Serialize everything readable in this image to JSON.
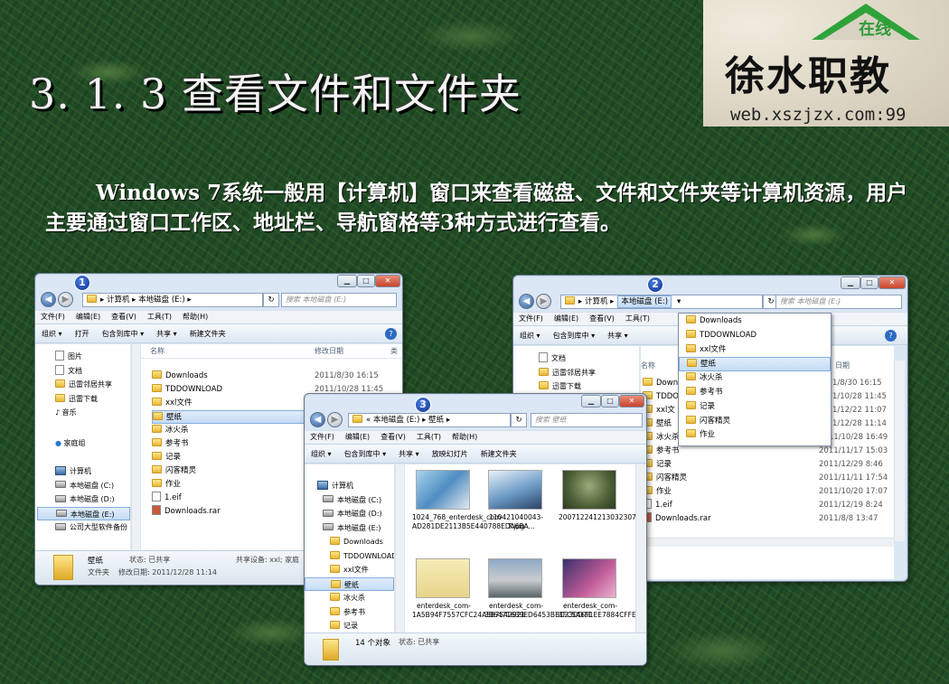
{
  "slide": {
    "title": "3. 1. 3  查看文件和文件夹",
    "paragraph": "Windows 7系统一般用【计算机】窗口来查看磁盘、文件和文件夹等计算机资源，用户主要通过窗口工作区、地址栏、导航窗格等3种方式进行查看。"
  },
  "logo": {
    "zaixian": "在线",
    "name": "徐水职教",
    "url": "web.xszjzx.com:99"
  },
  "badges": [
    "1",
    "2",
    "3"
  ],
  "win1": {
    "path": "▸ 计算机 ▸ 本地磁盘 (E:) ▸",
    "search_placeholder": "搜索 本地磁盘 (E:)",
    "menu": [
      "文件(F)",
      "编辑(E)",
      "查看(V)",
      "工具(T)",
      "帮助(H)"
    ],
    "toolbar": [
      "组织 ▾",
      "打开",
      "包含到库中 ▾",
      "共享 ▾",
      "新建文件夹"
    ],
    "nav": [
      "图片",
      "文档",
      "迅雷邻居共享",
      "迅雷下载",
      "音乐",
      "家庭组",
      "计算机",
      "本地磁盘 (C:)",
      "本地磁盘 (D:)",
      "本地磁盘 (E:)",
      "公司大型软件备份"
    ],
    "columns": {
      "name": "名称",
      "date": "修改日期",
      "type": "类"
    },
    "files": [
      {
        "name": "Downloads",
        "date": "2011/8/30 16:15"
      },
      {
        "name": "TDDOWNLOAD",
        "date": "2011/10/28 11:45"
      },
      {
        "name": "xxl文件",
        "date": ""
      },
      {
        "name": "壁纸",
        "date": ""
      },
      {
        "name": "冰火杀",
        "date": ""
      },
      {
        "name": "参考书",
        "date": ""
      },
      {
        "name": "记录",
        "date": ""
      },
      {
        "name": "闪客精灵",
        "date": ""
      },
      {
        "name": "作业",
        "date": ""
      },
      {
        "name": "1.eif",
        "date": ""
      },
      {
        "name": "Downloads.rar",
        "date": ""
      }
    ],
    "status": {
      "name": "壁纸",
      "state": "状态: 已共享",
      "share": "共享设备: xxl; 家庭",
      "kind": "文件夹",
      "modified": "修改日期: 2011/12/28 11:14"
    }
  },
  "win2": {
    "path": "▸ 计算机 ▸",
    "drive": "本地磁盘 (E:)",
    "search_placeholder": "搜索 本地磁盘 (E:)",
    "menu": [
      "文件(F)",
      "编辑(E)",
      "查看(V)",
      "工具(T)"
    ],
    "toolbar": [
      "组织 ▾",
      "包含到库中 ▾",
      "共享 ▾"
    ],
    "nav": [
      "文档",
      "迅雷邻居共享",
      "迅雷下载",
      "音乐"
    ],
    "dropdown": [
      "Downloads",
      "TDDOWNLOAD",
      "xxl文件",
      "壁纸",
      "冰火杀",
      "参考书",
      "记录",
      "闪客精灵",
      "作业"
    ],
    "columns": {
      "name": "名称",
      "date": "日期"
    },
    "files": [
      {
        "name": "Down",
        "date": "1/8/30 16:15"
      },
      {
        "name": "TDDO",
        "date": "1/10/28 11:45"
      },
      {
        "name": "xxl文",
        "date": "1/12/22 11:07"
      },
      {
        "name": "壁纸",
        "date": "1/12/28 11:14"
      },
      {
        "name": "冰火杀",
        "date": "2011/10/28 16:49"
      },
      {
        "name": "参考书",
        "date": "2011/11/17 15:03"
      },
      {
        "name": "记录",
        "date": "2011/12/29 8:46"
      },
      {
        "name": "闪客精灵",
        "date": "2011/11/11 17:54"
      },
      {
        "name": "作业",
        "date": "2011/10/20 17:07"
      },
      {
        "name": "1.eif",
        "date": "2011/12/19 8:24"
      },
      {
        "name": "Downloads.rar",
        "date": "2011/8/8 13:47"
      }
    ]
  },
  "win3": {
    "path": "« 本地磁盘 (E:) ▸ 壁纸 ▸",
    "search_placeholder": "搜索 壁纸",
    "menu": [
      "文件(F)",
      "编辑(E)",
      "查看(V)",
      "工具(T)",
      "帮助(H)"
    ],
    "toolbar": [
      "组织 ▾",
      "包含到库中 ▾",
      "共享 ▾",
      "放映幻灯片",
      "新建文件夹"
    ],
    "nav": [
      "计算机",
      "本地磁盘 (C:)",
      "本地磁盘 (D:)",
      "本地磁盘 (E:)",
      "Downloads",
      "TDDOWNLOAD",
      "xxl文件",
      "壁纸",
      "冰火杀",
      "参考书",
      "记录"
    ],
    "images": [
      {
        "caption": "1024_768_enterdesk_com-AD281DE2113B5E440788EDA6BA..."
      },
      {
        "caption": "110421040043-7.jpg"
      },
      {
        "caption": "200712241213032307.jpg"
      },
      {
        "caption": "enterdesk_com-1A5B94F7557CFC24A587542921"
      },
      {
        "caption": "enterdesk_com-3B6471639ED6453BBC23DD71"
      },
      {
        "caption": "enterdesk_com-3FC5A691EE7884CFFE2791C22D"
      }
    ],
    "status": {
      "count": "14 个对象",
      "state": "状态: 已共享"
    }
  }
}
